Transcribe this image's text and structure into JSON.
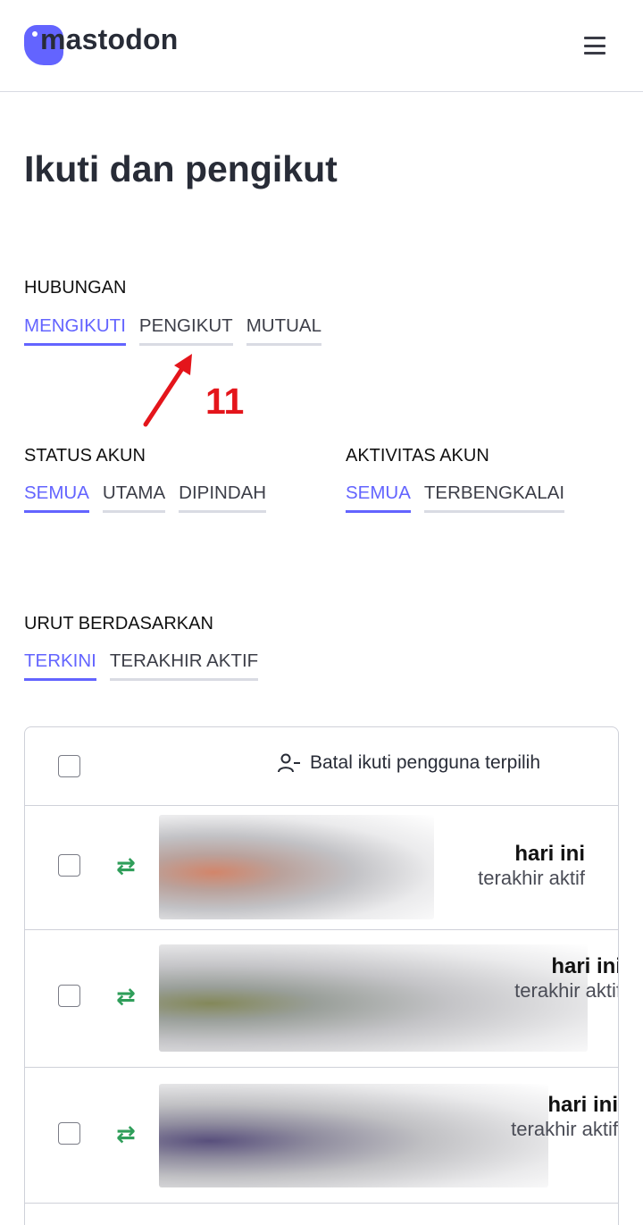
{
  "header": {
    "logo_text": "mastodon",
    "menu_icon": "hamburger-icon"
  },
  "page_title": "Ikuti dan pengikut",
  "filters": {
    "relationship": {
      "label": "HUBUNGAN",
      "options": [
        "MENGIKUTI",
        "PENGIKUT",
        "MUTUAL"
      ],
      "selected": "MENGIKUTI"
    },
    "account_status": {
      "label": "STATUS AKUN",
      "options": [
        "SEMUA",
        "UTAMA",
        "DIPINDAH"
      ],
      "selected": "SEMUA"
    },
    "account_activity": {
      "label": "AKTIVITAS AKUN",
      "options": [
        "SEMUA",
        "TERBENGKALAI"
      ],
      "selected": "SEMUA"
    },
    "order": {
      "label": "URUT BERDASARKAN",
      "options": [
        "TERKINI",
        "TERAKHIR AKTIF"
      ],
      "selected": "TERKINI"
    }
  },
  "annotation": {
    "number": "11",
    "color": "#e4151b"
  },
  "table": {
    "bulk_action_label": "Batal ikuti pengguna terpilih",
    "bulk_action_icon": "user-minus-icon",
    "rows": [
      {
        "relationship_icon": "mutual-arrows-icon",
        "last_active_value": "hari ini",
        "last_active_label": "terakhir aktif",
        "avatar": "redacted"
      },
      {
        "relationship_icon": "mutual-arrows-icon",
        "last_active_value": "hari ini",
        "last_active_label": "terakhir aktif",
        "avatar": "redacted"
      },
      {
        "relationship_icon": "mutual-arrows-icon",
        "last_active_value": "hari ini",
        "last_active_label": "terakhir aktif",
        "avatar": "redacted"
      }
    ]
  },
  "colors": {
    "accent": "#6364ff",
    "mutual_icon": "#2f9e5a",
    "text": "#282c37"
  }
}
